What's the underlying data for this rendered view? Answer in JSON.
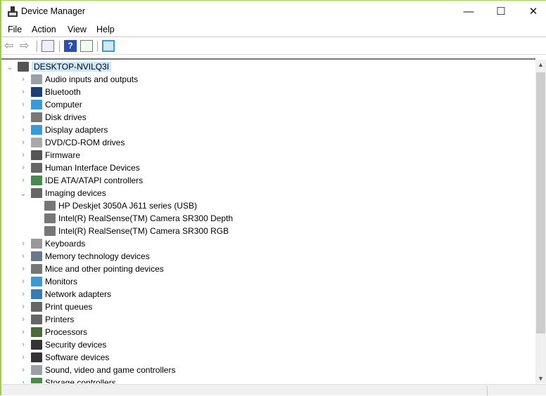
{
  "window": {
    "title": "Device Manager",
    "minimize": "—",
    "maximize": "☐",
    "close": "✕"
  },
  "menu": [
    "File",
    "Action",
    "View",
    "Help"
  ],
  "toolbar": {
    "help": "?"
  },
  "tree": {
    "root": "DESKTOP-NVILQ3I",
    "items": [
      {
        "label": "Audio inputs and outputs",
        "icon": "speaker-icon",
        "color": "#9aa0a6"
      },
      {
        "label": "Bluetooth",
        "icon": "bluetooth-icon",
        "color": "#1c3f7a"
      },
      {
        "label": "Computer",
        "icon": "computer-icon",
        "color": "#3a9ad9"
      },
      {
        "label": "Disk drives",
        "icon": "disk-icon",
        "color": "#777"
      },
      {
        "label": "Display adapters",
        "icon": "display-adapter-icon",
        "color": "#3a9ad9"
      },
      {
        "label": "DVD/CD-ROM drives",
        "icon": "dvd-icon",
        "color": "#aaa"
      },
      {
        "label": "Firmware",
        "icon": "firmware-icon",
        "color": "#555"
      },
      {
        "label": "Human Interface Devices",
        "icon": "hid-icon",
        "color": "#666"
      },
      {
        "label": "IDE ATA/ATAPI controllers",
        "icon": "ide-icon",
        "color": "#4a8a4a"
      },
      {
        "label": "Imaging devices",
        "icon": "camera-icon",
        "color": "#666",
        "expanded": true,
        "children": [
          "HP Deskjet 3050A J611 series (USB)",
          "Intel(R) RealSense(TM) Camera SR300 Depth",
          "Intel(R) RealSense(TM) Camera SR300 RGB"
        ]
      },
      {
        "label": "Keyboards",
        "icon": "keyboard-icon",
        "color": "#999"
      },
      {
        "label": "Memory technology devices",
        "icon": "memory-icon",
        "color": "#6a7a8a"
      },
      {
        "label": "Mice and other pointing devices",
        "icon": "mouse-icon",
        "color": "#777"
      },
      {
        "label": "Monitors",
        "icon": "monitor-icon",
        "color": "#3a9ad9"
      },
      {
        "label": "Network adapters",
        "icon": "network-icon",
        "color": "#3a7ab9"
      },
      {
        "label": "Print queues",
        "icon": "print-queue-icon",
        "color": "#666"
      },
      {
        "label": "Printers",
        "icon": "printer-icon",
        "color": "#666"
      },
      {
        "label": "Processors",
        "icon": "processor-icon",
        "color": "#4a6a3a"
      },
      {
        "label": "Security devices",
        "icon": "security-icon",
        "color": "#333"
      },
      {
        "label": "Software devices",
        "icon": "software-device-icon",
        "color": "#333"
      },
      {
        "label": "Sound, video and game controllers",
        "icon": "speaker-icon",
        "color": "#9aa0a6"
      },
      {
        "label": "Storage controllers",
        "icon": "storage-icon",
        "color": "#4a8a4a"
      }
    ]
  }
}
